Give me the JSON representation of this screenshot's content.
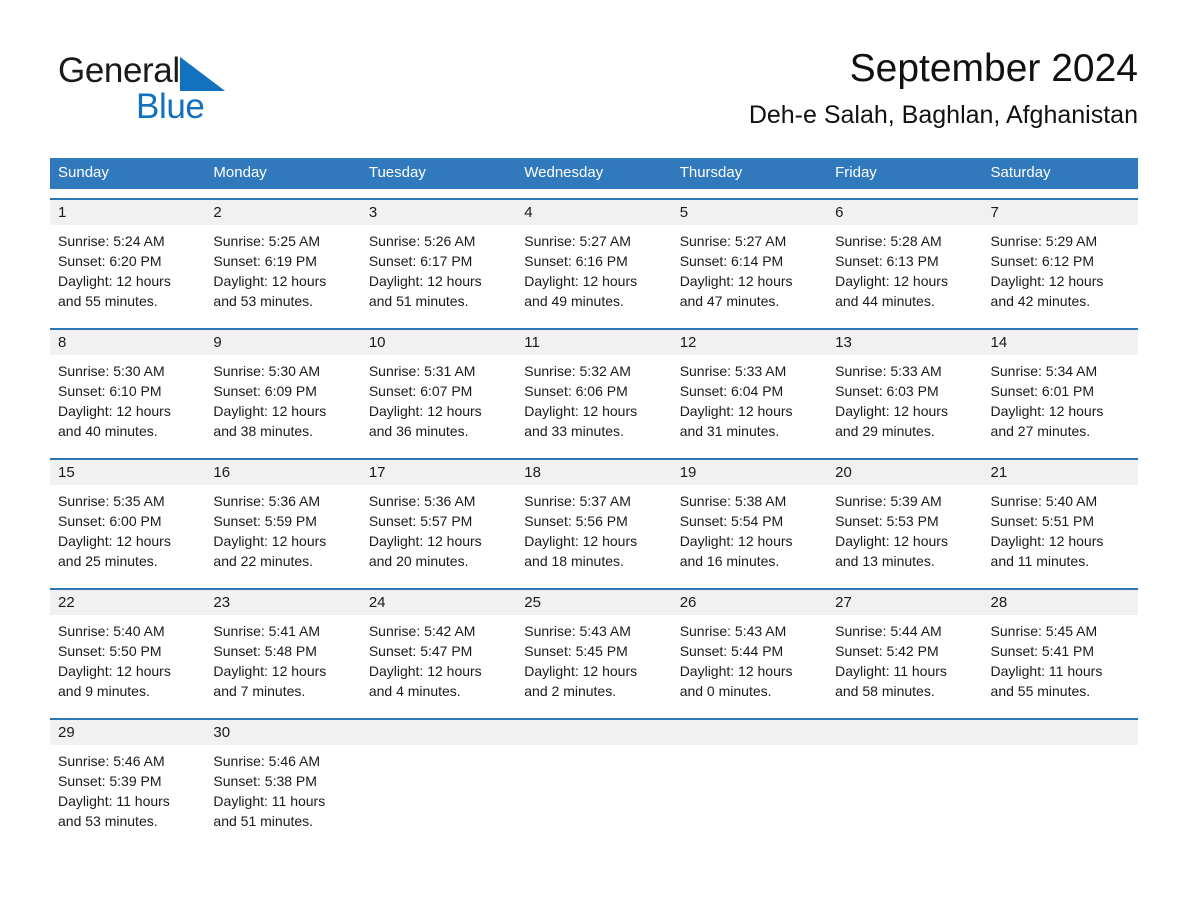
{
  "brand": {
    "name_dark": "General",
    "name_blue": "Blue",
    "triangle_color": "#1272c0"
  },
  "header": {
    "title": "September 2024",
    "subtitle": "Deh-e Salah, Baghlan, Afghanistan"
  },
  "theme": {
    "header_blue": "#3179bd",
    "rule_blue": "#2e75b6",
    "date_band": "#f1f1f1",
    "text": "#1a1a1a",
    "background": "#ffffff"
  },
  "weekdays": [
    "Sunday",
    "Monday",
    "Tuesday",
    "Wednesday",
    "Thursday",
    "Friday",
    "Saturday"
  ],
  "weeks": [
    {
      "days": [
        {
          "num": "1",
          "sunrise": "Sunrise: 5:24 AM",
          "sunset": "Sunset: 6:20 PM",
          "daylight1": "Daylight: 12 hours",
          "daylight2": "and 55 minutes."
        },
        {
          "num": "2",
          "sunrise": "Sunrise: 5:25 AM",
          "sunset": "Sunset: 6:19 PM",
          "daylight1": "Daylight: 12 hours",
          "daylight2": "and 53 minutes."
        },
        {
          "num": "3",
          "sunrise": "Sunrise: 5:26 AM",
          "sunset": "Sunset: 6:17 PM",
          "daylight1": "Daylight: 12 hours",
          "daylight2": "and 51 minutes."
        },
        {
          "num": "4",
          "sunrise": "Sunrise: 5:27 AM",
          "sunset": "Sunset: 6:16 PM",
          "daylight1": "Daylight: 12 hours",
          "daylight2": "and 49 minutes."
        },
        {
          "num": "5",
          "sunrise": "Sunrise: 5:27 AM",
          "sunset": "Sunset: 6:14 PM",
          "daylight1": "Daylight: 12 hours",
          "daylight2": "and 47 minutes."
        },
        {
          "num": "6",
          "sunrise": "Sunrise: 5:28 AM",
          "sunset": "Sunset: 6:13 PM",
          "daylight1": "Daylight: 12 hours",
          "daylight2": "and 44 minutes."
        },
        {
          "num": "7",
          "sunrise": "Sunrise: 5:29 AM",
          "sunset": "Sunset: 6:12 PM",
          "daylight1": "Daylight: 12 hours",
          "daylight2": "and 42 minutes."
        }
      ]
    },
    {
      "days": [
        {
          "num": "8",
          "sunrise": "Sunrise: 5:30 AM",
          "sunset": "Sunset: 6:10 PM",
          "daylight1": "Daylight: 12 hours",
          "daylight2": "and 40 minutes."
        },
        {
          "num": "9",
          "sunrise": "Sunrise: 5:30 AM",
          "sunset": "Sunset: 6:09 PM",
          "daylight1": "Daylight: 12 hours",
          "daylight2": "and 38 minutes."
        },
        {
          "num": "10",
          "sunrise": "Sunrise: 5:31 AM",
          "sunset": "Sunset: 6:07 PM",
          "daylight1": "Daylight: 12 hours",
          "daylight2": "and 36 minutes."
        },
        {
          "num": "11",
          "sunrise": "Sunrise: 5:32 AM",
          "sunset": "Sunset: 6:06 PM",
          "daylight1": "Daylight: 12 hours",
          "daylight2": "and 33 minutes."
        },
        {
          "num": "12",
          "sunrise": "Sunrise: 5:33 AM",
          "sunset": "Sunset: 6:04 PM",
          "daylight1": "Daylight: 12 hours",
          "daylight2": "and 31 minutes."
        },
        {
          "num": "13",
          "sunrise": "Sunrise: 5:33 AM",
          "sunset": "Sunset: 6:03 PM",
          "daylight1": "Daylight: 12 hours",
          "daylight2": "and 29 minutes."
        },
        {
          "num": "14",
          "sunrise": "Sunrise: 5:34 AM",
          "sunset": "Sunset: 6:01 PM",
          "daylight1": "Daylight: 12 hours",
          "daylight2": "and 27 minutes."
        }
      ]
    },
    {
      "days": [
        {
          "num": "15",
          "sunrise": "Sunrise: 5:35 AM",
          "sunset": "Sunset: 6:00 PM",
          "daylight1": "Daylight: 12 hours",
          "daylight2": "and 25 minutes."
        },
        {
          "num": "16",
          "sunrise": "Sunrise: 5:36 AM",
          "sunset": "Sunset: 5:59 PM",
          "daylight1": "Daylight: 12 hours",
          "daylight2": "and 22 minutes."
        },
        {
          "num": "17",
          "sunrise": "Sunrise: 5:36 AM",
          "sunset": "Sunset: 5:57 PM",
          "daylight1": "Daylight: 12 hours",
          "daylight2": "and 20 minutes."
        },
        {
          "num": "18",
          "sunrise": "Sunrise: 5:37 AM",
          "sunset": "Sunset: 5:56 PM",
          "daylight1": "Daylight: 12 hours",
          "daylight2": "and 18 minutes."
        },
        {
          "num": "19",
          "sunrise": "Sunrise: 5:38 AM",
          "sunset": "Sunset: 5:54 PM",
          "daylight1": "Daylight: 12 hours",
          "daylight2": "and 16 minutes."
        },
        {
          "num": "20",
          "sunrise": "Sunrise: 5:39 AM",
          "sunset": "Sunset: 5:53 PM",
          "daylight1": "Daylight: 12 hours",
          "daylight2": "and 13 minutes."
        },
        {
          "num": "21",
          "sunrise": "Sunrise: 5:40 AM",
          "sunset": "Sunset: 5:51 PM",
          "daylight1": "Daylight: 12 hours",
          "daylight2": "and 11 minutes."
        }
      ]
    },
    {
      "days": [
        {
          "num": "22",
          "sunrise": "Sunrise: 5:40 AM",
          "sunset": "Sunset: 5:50 PM",
          "daylight1": "Daylight: 12 hours",
          "daylight2": "and 9 minutes."
        },
        {
          "num": "23",
          "sunrise": "Sunrise: 5:41 AM",
          "sunset": "Sunset: 5:48 PM",
          "daylight1": "Daylight: 12 hours",
          "daylight2": "and 7 minutes."
        },
        {
          "num": "24",
          "sunrise": "Sunrise: 5:42 AM",
          "sunset": "Sunset: 5:47 PM",
          "daylight1": "Daylight: 12 hours",
          "daylight2": "and 4 minutes."
        },
        {
          "num": "25",
          "sunrise": "Sunrise: 5:43 AM",
          "sunset": "Sunset: 5:45 PM",
          "daylight1": "Daylight: 12 hours",
          "daylight2": "and 2 minutes."
        },
        {
          "num": "26",
          "sunrise": "Sunrise: 5:43 AM",
          "sunset": "Sunset: 5:44 PM",
          "daylight1": "Daylight: 12 hours",
          "daylight2": "and 0 minutes."
        },
        {
          "num": "27",
          "sunrise": "Sunrise: 5:44 AM",
          "sunset": "Sunset: 5:42 PM",
          "daylight1": "Daylight: 11 hours",
          "daylight2": "and 58 minutes."
        },
        {
          "num": "28",
          "sunrise": "Sunrise: 5:45 AM",
          "sunset": "Sunset: 5:41 PM",
          "daylight1": "Daylight: 11 hours",
          "daylight2": "and 55 minutes."
        }
      ]
    },
    {
      "days": [
        {
          "num": "29",
          "sunrise": "Sunrise: 5:46 AM",
          "sunset": "Sunset: 5:39 PM",
          "daylight1": "Daylight: 11 hours",
          "daylight2": "and 53 minutes."
        },
        {
          "num": "30",
          "sunrise": "Sunrise: 5:46 AM",
          "sunset": "Sunset: 5:38 PM",
          "daylight1": "Daylight: 11 hours",
          "daylight2": "and 51 minutes."
        },
        {
          "num": "",
          "sunrise": "",
          "sunset": "",
          "daylight1": "",
          "daylight2": ""
        },
        {
          "num": "",
          "sunrise": "",
          "sunset": "",
          "daylight1": "",
          "daylight2": ""
        },
        {
          "num": "",
          "sunrise": "",
          "sunset": "",
          "daylight1": "",
          "daylight2": ""
        },
        {
          "num": "",
          "sunrise": "",
          "sunset": "",
          "daylight1": "",
          "daylight2": ""
        },
        {
          "num": "",
          "sunrise": "",
          "sunset": "",
          "daylight1": "",
          "daylight2": ""
        }
      ]
    }
  ]
}
